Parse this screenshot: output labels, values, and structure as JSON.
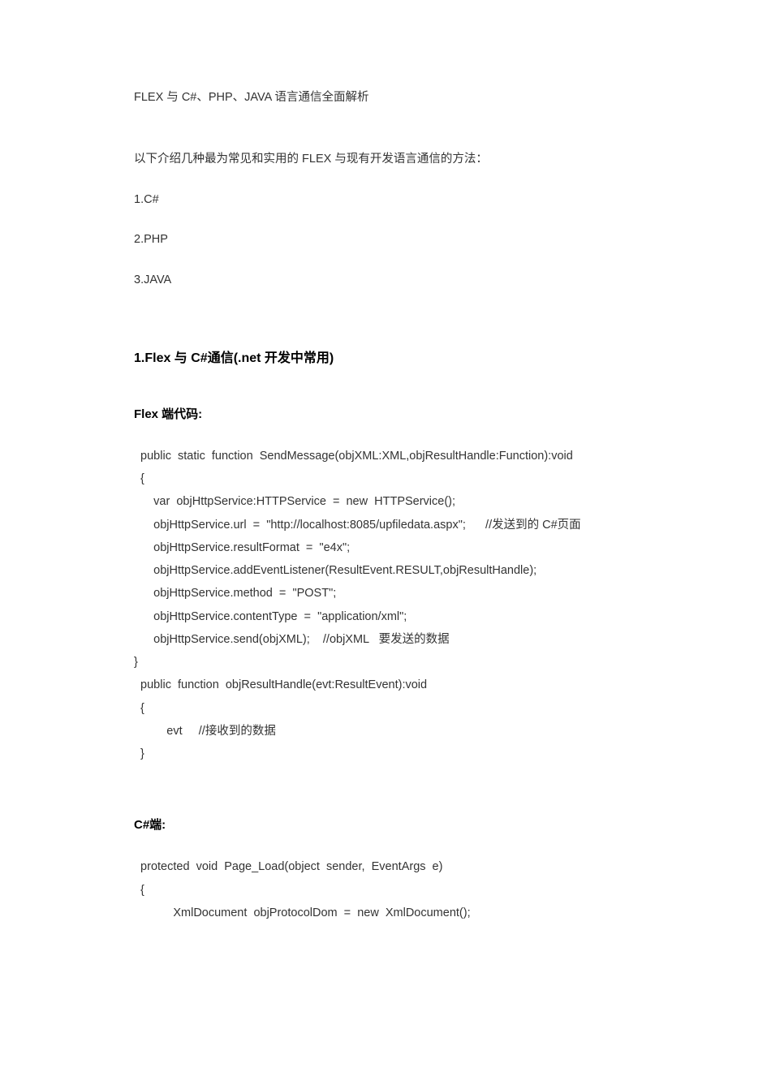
{
  "title": "FLEX 与 C#、PHP、JAVA 语言通信全面解析",
  "intro": "以下介绍几种最为常见和实用的 FLEX 与现有开发语言通信的方法：",
  "list": {
    "i1": "1.C#",
    "i2": "2.PHP",
    "i3": "3.JAVA"
  },
  "section1_heading": "1.Flex 与 C#通信(.net 开发中常用)",
  "flex_label": "Flex 端代码:",
  "flex_code": {
    "l1": "  public  static  function  SendMessage(objXML:XML,objResultHandle:Function):void",
    "l2": "  {",
    "l3": "      var  objHttpService:HTTPService  =  new  HTTPService();",
    "l4": "      objHttpService.url  =  \"http://localhost:8085/upfiledata.aspx\";      //发送到的 C#页面",
    "l5": "      objHttpService.resultFormat  =  \"e4x\";",
    "l6": "      objHttpService.addEventListener(ResultEvent.RESULT,objResultHandle);",
    "l7": "      objHttpService.method  =  \"POST\";",
    "l8": "      objHttpService.contentType  =  \"application/xml\";",
    "l9": "      objHttpService.send(objXML);    //objXML   要发送的数据",
    "l10": "}",
    "l11": "",
    "l12": "  public  function  objResultHandle(evt:ResultEvent):void",
    "l13": "  {",
    "l14": "          evt     //接收到的数据",
    "l15": "  }"
  },
  "csharp_label": "C#端:",
  "csharp_code": {
    "l1": "  protected  void  Page_Load(object  sender,  EventArgs  e)",
    "l2": "  {",
    "l3": "            XmlDocument  objProtocolDom  =  new  XmlDocument();"
  }
}
